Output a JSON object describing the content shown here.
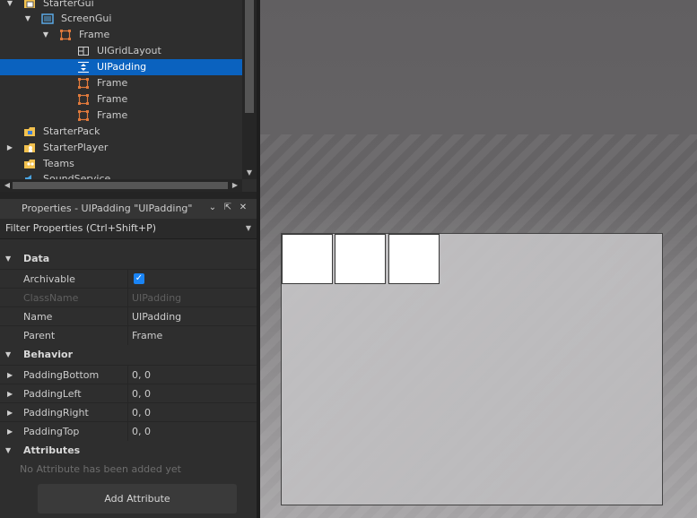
{
  "explorer": {
    "items": [
      {
        "label": "StarterGui",
        "icon": "starter-gui-icon"
      },
      {
        "label": "ScreenGui",
        "icon": "screen-gui-icon"
      },
      {
        "label": "Frame",
        "icon": "frame-icon"
      },
      {
        "label": "UIGridLayout",
        "icon": "ui-grid-layout-icon"
      },
      {
        "label": "UIPadding",
        "icon": "ui-padding-icon"
      },
      {
        "label": "Frame",
        "icon": "frame-icon"
      },
      {
        "label": "Frame",
        "icon": "frame-icon"
      },
      {
        "label": "Frame",
        "icon": "frame-icon"
      },
      {
        "label": "StarterPack",
        "icon": "starter-pack-icon"
      },
      {
        "label": "StarterPlayer",
        "icon": "starter-player-icon"
      },
      {
        "label": "Teams",
        "icon": "teams-icon"
      },
      {
        "label": "SoundService",
        "icon": "sound-service-icon"
      }
    ]
  },
  "properties": {
    "title": "Properties - UIPadding \"UIPadding\"",
    "filter_placeholder": "Filter Properties (Ctrl+Shift+P)",
    "categories": {
      "data": "Data",
      "behavior": "Behavior",
      "attributes": "Attributes"
    },
    "data_rows": [
      {
        "key": "Archivable",
        "value": ""
      },
      {
        "key": "ClassName",
        "value": "UIPadding"
      },
      {
        "key": "Name",
        "value": "UIPadding"
      },
      {
        "key": "Parent",
        "value": "Frame"
      }
    ],
    "behavior_rows": [
      {
        "key": "PaddingBottom",
        "value": "0, 0"
      },
      {
        "key": "PaddingLeft",
        "value": "0, 0"
      },
      {
        "key": "PaddingRight",
        "value": "0, 0"
      },
      {
        "key": "PaddingTop",
        "value": "0, 0"
      }
    ],
    "no_attributes_text": "No Attribute has been added yet",
    "add_attribute_label": "Add Attribute"
  },
  "colors": {
    "selection": "#0a62bf",
    "checkbox": "#1a84f5",
    "frame_icon": "#e07a3c"
  }
}
